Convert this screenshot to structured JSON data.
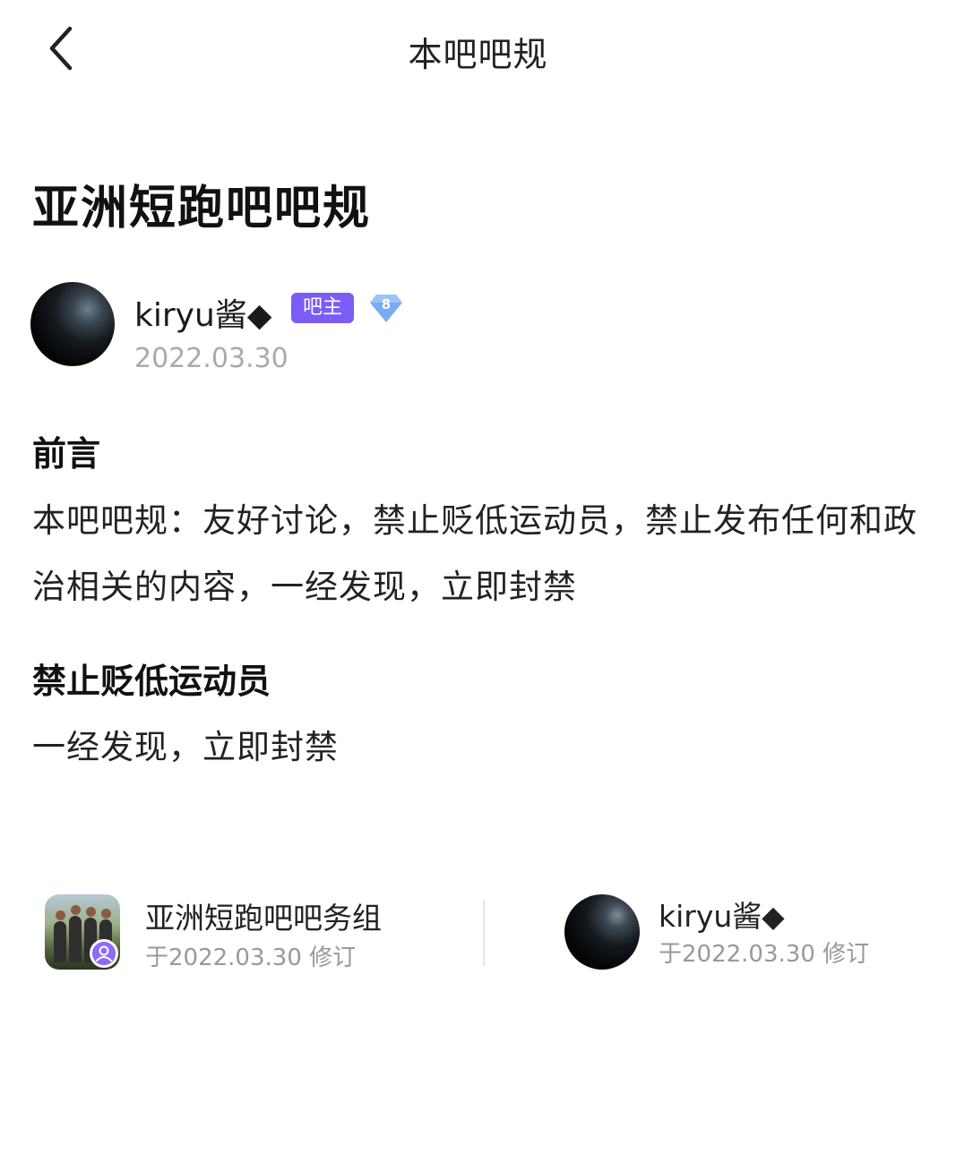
{
  "nav": {
    "title": "本吧吧规",
    "back_icon": "chevron-left-icon"
  },
  "article": {
    "title": "亚洲短跑吧吧规",
    "author": {
      "name": "kiryu酱◆",
      "role_badge": "吧主",
      "level": "8",
      "date": "2022.03.30"
    },
    "sections": [
      {
        "heading": "前言",
        "body": "本吧吧规：友好讨论，禁止贬低运动员，禁止发布任何和政治相关的内容，一经发现，立即封禁"
      },
      {
        "heading": "禁止贬低运动员",
        "body": "一经发现，立即封禁"
      }
    ]
  },
  "revisions": [
    {
      "name": "亚洲短跑吧吧务组",
      "meta": "于2022.03.30 修订"
    },
    {
      "name": "kiryu酱◆",
      "meta": "于2022.03.30 修订"
    }
  ],
  "colors": {
    "badge_owner": "#7b5cf5",
    "badge_level": "#7aaaf5",
    "muted_text": "#aaaaaa"
  }
}
